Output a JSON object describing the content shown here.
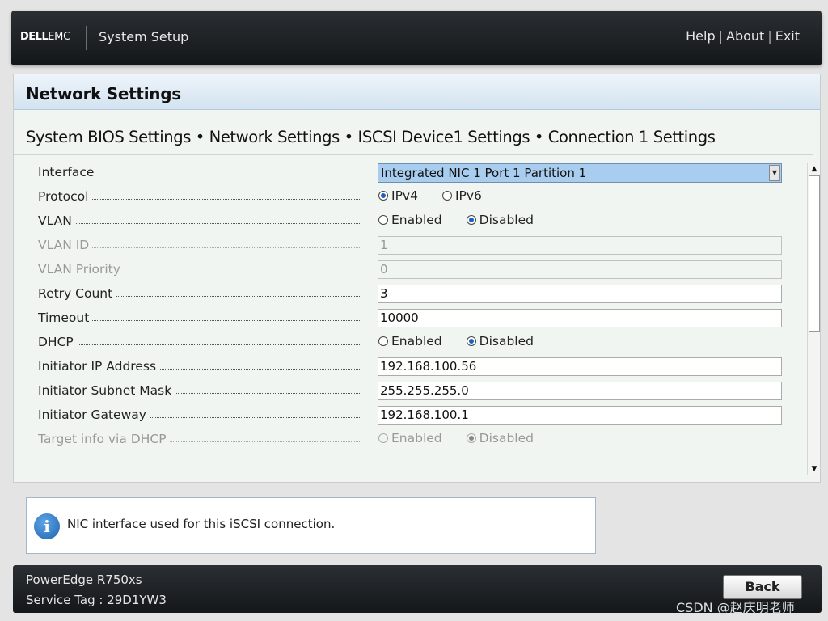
{
  "header": {
    "logo_main": "DELL",
    "logo_sub": "EMC",
    "app_title": "System Setup",
    "links": {
      "help": "Help",
      "about": "About",
      "exit": "Exit",
      "separator": "|"
    }
  },
  "page": {
    "title": "Network Settings",
    "breadcrumb": "System BIOS Settings • Network Settings • ISCSI Device1 Settings • Connection 1 Settings"
  },
  "settings": {
    "interface": {
      "label": "Interface",
      "value": "Integrated NIC 1 Port 1 Partition 1"
    },
    "protocol": {
      "label": "Protocol",
      "options": [
        "IPv4",
        "IPv6"
      ],
      "selected": "IPv4"
    },
    "vlan": {
      "label": "VLAN",
      "options": [
        "Enabled",
        "Disabled"
      ],
      "selected": "Disabled"
    },
    "vlan_id": {
      "label": "VLAN ID",
      "value": "1"
    },
    "vlan_priority": {
      "label": "VLAN Priority",
      "value": "0"
    },
    "retry_count": {
      "label": "Retry Count",
      "value": "3"
    },
    "timeout": {
      "label": "Timeout",
      "value": "10000"
    },
    "dhcp": {
      "label": "DHCP",
      "options": [
        "Enabled",
        "Disabled"
      ],
      "selected": "Disabled"
    },
    "initiator_ip": {
      "label": "Initiator IP Address",
      "value": "192.168.100.56"
    },
    "initiator_mask": {
      "label": "Initiator Subnet Mask",
      "value": "255.255.255.0"
    },
    "initiator_gateway": {
      "label": "Initiator Gateway",
      "value": "192.168.100.1"
    },
    "target_dhcp": {
      "label": "Target info via DHCP",
      "options": [
        "Enabled",
        "Disabled"
      ],
      "selected": "Disabled"
    }
  },
  "help": {
    "icon": "info-icon",
    "glyph": "i",
    "text": "NIC interface used for this iSCSI connection."
  },
  "footer": {
    "model": "PowerEdge R750xs",
    "service_tag": "Service Tag : 29D1YW3",
    "back_label": "Back"
  },
  "watermark": "CSDN @赵庆明老师",
  "colors": {
    "header_bg": "#1e2226",
    "title_bar": "#d3e3f1",
    "selected_field": "#a9cdee",
    "radio_on": "#1e5fbf",
    "info_icon": "#1e64b0"
  }
}
